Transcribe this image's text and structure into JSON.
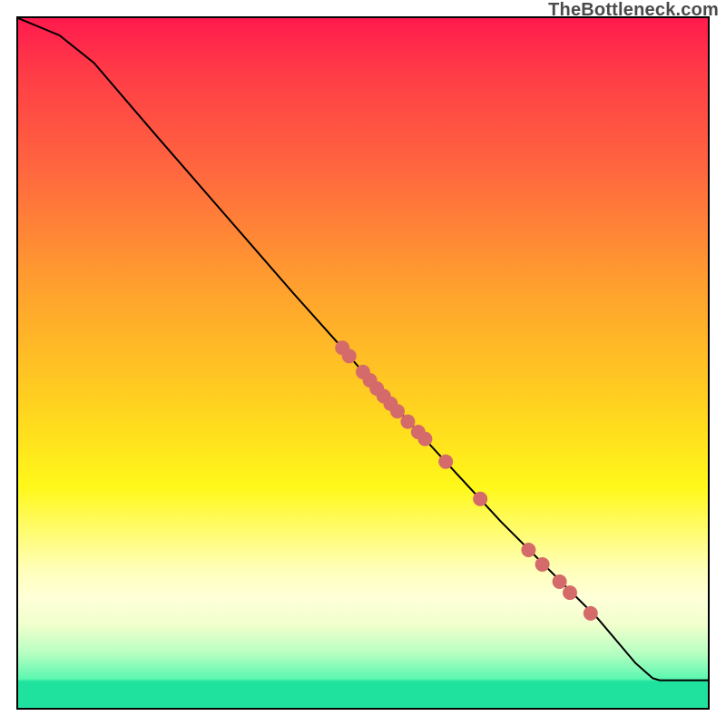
{
  "attribution": "TheBottleneck.com",
  "chart_data": {
    "type": "line",
    "title": "",
    "xlabel": "",
    "ylabel": "",
    "xlim": [
      0,
      100
    ],
    "ylim": [
      0,
      100
    ],
    "grid": false,
    "curve": [
      {
        "x": 0,
        "y": 100
      },
      {
        "x": 6,
        "y": 97.5
      },
      {
        "x": 11,
        "y": 93.5
      },
      {
        "x": 14,
        "y": 90
      },
      {
        "x": 20,
        "y": 83
      },
      {
        "x": 30,
        "y": 71.5
      },
      {
        "x": 40,
        "y": 60
      },
      {
        "x": 46,
        "y": 53.3
      },
      {
        "x": 50,
        "y": 48.7
      },
      {
        "x": 58,
        "y": 40
      },
      {
        "x": 64,
        "y": 33.5
      },
      {
        "x": 70,
        "y": 27
      },
      {
        "x": 78,
        "y": 19
      },
      {
        "x": 84,
        "y": 13
      },
      {
        "x": 89.5,
        "y": 6.5
      },
      {
        "x": 92,
        "y": 4.3
      },
      {
        "x": 93,
        "y": 4.0
      },
      {
        "x": 100,
        "y": 4.0
      }
    ],
    "points": [
      {
        "x": 47,
        "y": 52.2
      },
      {
        "x": 48,
        "y": 51.0
      },
      {
        "x": 50,
        "y": 48.7
      },
      {
        "x": 51,
        "y": 47.5
      },
      {
        "x": 52,
        "y": 46.3
      },
      {
        "x": 53,
        "y": 45.2
      },
      {
        "x": 54,
        "y": 44.1
      },
      {
        "x": 55,
        "y": 43.0
      },
      {
        "x": 56.5,
        "y": 41.5
      },
      {
        "x": 58,
        "y": 40.0
      },
      {
        "x": 59,
        "y": 39.0
      },
      {
        "x": 62,
        "y": 35.7
      },
      {
        "x": 67,
        "y": 30.3
      },
      {
        "x": 74,
        "y": 22.9
      },
      {
        "x": 76,
        "y": 20.8
      },
      {
        "x": 78.5,
        "y": 18.3
      },
      {
        "x": 80,
        "y": 16.7
      },
      {
        "x": 83,
        "y": 13.7
      }
    ],
    "point_color": "#d56a6a",
    "line_color": "#000000"
  }
}
